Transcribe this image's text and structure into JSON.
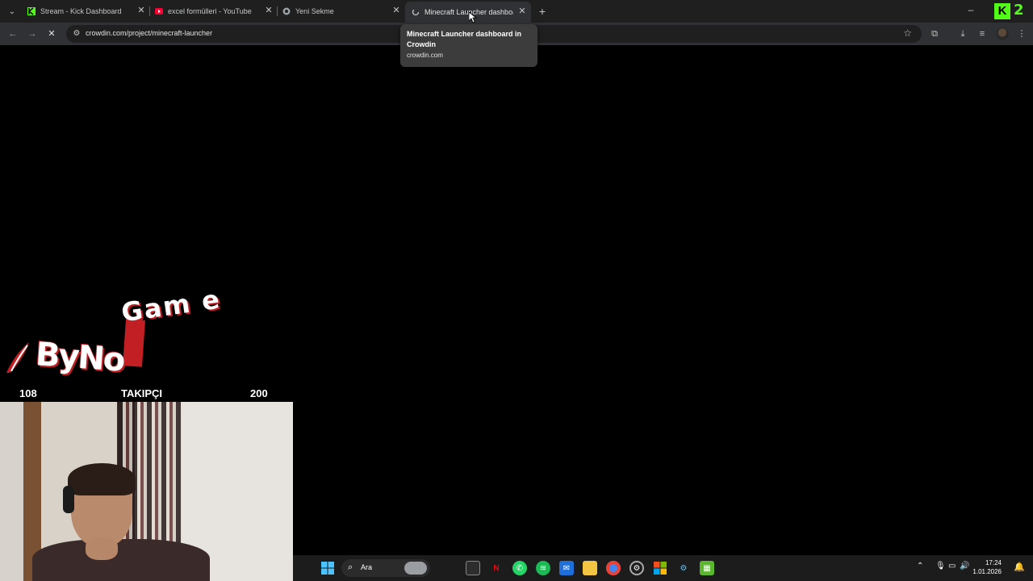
{
  "browser": {
    "tabs": [
      {
        "title": "Stream - Kick Dashboard",
        "favicon": "kick-icon",
        "color": "#53fc18"
      },
      {
        "title": "excel formülleri - YouTube",
        "favicon": "youtube-icon",
        "color": "#ff0033"
      },
      {
        "title": "Yeni Sekme",
        "favicon": "chrome-icon"
      },
      {
        "title": "Minecraft Launcher dashboard",
        "favicon": "crowdin-icon",
        "active": true
      }
    ],
    "url": "crowdin.com/project/minecraft-launcher",
    "badge_number": "2"
  },
  "tooltip": {
    "title": "Minecraft Launcher dashboard in Crowdin",
    "domain": "crowdin.com"
  },
  "overlay": {
    "logo_word1": "ByNo",
    "logo_word2": "Gam e",
    "goal_current": "108",
    "goal_label": "TAKIPÇI",
    "goal_target": "200"
  },
  "taskbar": {
    "search_label": "Ara",
    "time": "17:24",
    "date": "1.01.2026",
    "accent_colors": {
      "windows": "#4cc2ff",
      "whatsapp": "#25d366",
      "spotify": "#1db954",
      "chrome": "#4285f4",
      "minecraft": "#5bb82e"
    }
  }
}
